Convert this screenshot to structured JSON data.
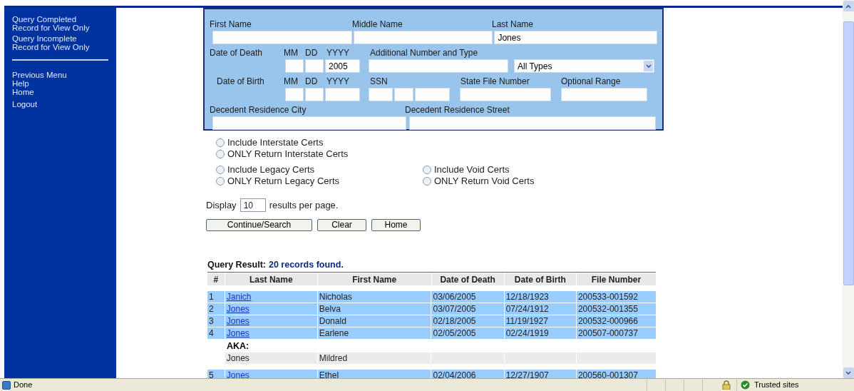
{
  "sidebar": {
    "groups": [
      [
        {
          "label": "Query Completed Record for View Only"
        },
        {
          "label": "Query Incomplete Record for View Only"
        }
      ],
      [
        {
          "label": "Previous Menu"
        },
        {
          "label": "Help"
        },
        {
          "label": "Home"
        },
        {
          "label": "Logout"
        }
      ]
    ]
  },
  "search_form": {
    "name_row": [
      {
        "label": "First Name"
      },
      {
        "label": "Middle Name"
      },
      {
        "label": "Last Name",
        "value": "Jones"
      }
    ],
    "date_of_death": {
      "label": "Date of Death",
      "parts": [
        {
          "label": "MM"
        },
        {
          "label": "DD"
        },
        {
          "label": "YYYY",
          "value": "2005"
        }
      ]
    },
    "additional_number": {
      "label": "Additional Number and Type",
      "type_select": "All Types"
    },
    "date_of_birth": {
      "label": "Date of Birth",
      "parts": [
        {
          "label": "MM"
        },
        {
          "label": "DD"
        },
        {
          "label": "YYYY"
        }
      ]
    },
    "ssn": {
      "label": "SSN"
    },
    "state_file_number": {
      "label": "State File Number"
    },
    "optional_range": {
      "label": "Optional Range"
    },
    "residence_city": {
      "label": "Decedent Residence City"
    },
    "residence_street": {
      "label": "Decedent Residence Street"
    }
  },
  "options": [
    [
      {
        "label": "Include Interstate Certs",
        "selected": false
      },
      {
        "label": "ONLY Return Interstate Certs",
        "selected": false
      }
    ],
    [
      {
        "label": "Include Legacy Certs",
        "selected": false
      },
      {
        "label": "ONLY Return Legacy Certs",
        "selected": false
      }
    ],
    [
      {
        "label": "Include Void Certs",
        "selected": false
      },
      {
        "label": "ONLY Return Void Certs",
        "selected": false
      }
    ]
  ],
  "display": {
    "before": "Display",
    "value": "10",
    "after": "results per page."
  },
  "buttons": [
    "Continue/Search",
    "Clear",
    "Home"
  ],
  "results": {
    "title": "Query Result:",
    "count": "20 records found.",
    "columns": [
      "#",
      "Last Name",
      "First Name",
      "Date of Death",
      "Date of Birth",
      "File Number"
    ],
    "rows": [
      {
        "kind": "record",
        "cells": [
          "1",
          "Janich",
          "Nicholas",
          "03/06/2005",
          "12/18/1923",
          "200533-001592"
        ]
      },
      {
        "kind": "record",
        "cells": [
          "2",
          "Jones",
          "Belva",
          "03/07/2005",
          "07/24/1912",
          "200532-001355"
        ]
      },
      {
        "kind": "record",
        "cells": [
          "3",
          "Jones",
          "Donald",
          "02/18/2005",
          "11/19/1927",
          "200532-000966"
        ]
      },
      {
        "kind": "record",
        "cells": [
          "4",
          "Jones",
          "Earlene",
          "02/05/2005",
          "02/24/1919",
          "200507-000737"
        ]
      },
      {
        "kind": "aka_label",
        "cells": [
          null,
          "AKA:"
        ]
      },
      {
        "kind": "aka",
        "cells": [
          null,
          "Jones",
          "Mildred",
          null,
          null,
          null
        ]
      },
      {
        "kind": "record",
        "cells": [
          "5",
          "Jones",
          "Ethel",
          "02/04/2006",
          "12/27/1907",
          "200560-001307"
        ]
      }
    ]
  },
  "status_bar": {
    "text": "Done",
    "zone": "Trusted sites"
  }
}
